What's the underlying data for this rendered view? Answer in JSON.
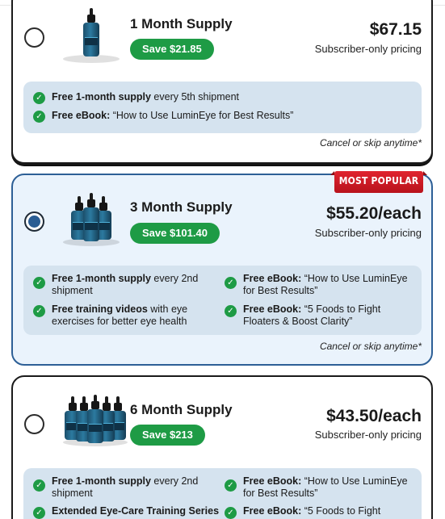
{
  "plans": [
    {
      "name": "1 Month Supply",
      "save": "Save $21.85",
      "price": "$67.15",
      "price_note": "Subscriber-only pricing",
      "selected": false,
      "bottles": 1,
      "perks": [
        {
          "bold": "Free 1-month supply",
          "text": " every 5th shipment"
        },
        {
          "bold": "Free eBook:",
          "text": " “How to Use LuminEye for Best Results”"
        }
      ],
      "cancel_note": "Cancel or skip anytime*"
    },
    {
      "name": "3 Month Supply",
      "save": "Save $101.40",
      "price": "$55.20/each",
      "price_note": "Subscriber-only pricing",
      "selected": true,
      "badge": "MOST POPULAR",
      "bottles": 3,
      "perks": [
        {
          "bold": "Free 1-month supply",
          "text": " every 2nd shipment"
        },
        {
          "bold": "Free eBook:",
          "text": " “How to Use LuminEye for Best Results”"
        },
        {
          "bold": "Free training videos",
          "text": " with eye exercises for better eye health"
        },
        {
          "bold": "Free eBook:",
          "text": " “5 Foods to Fight Floaters & Boost Clarity”"
        }
      ],
      "cancel_note": "Cancel or skip anytime*"
    },
    {
      "name": "6 Month Supply",
      "save": "Save $213",
      "price": "$43.50/each",
      "price_note": "Subscriber-only pricing",
      "selected": false,
      "bottles": 5,
      "perks": [
        {
          "bold": "Free 1-month supply",
          "text": " every 2nd shipment"
        },
        {
          "bold": "Free eBook:",
          "text": " “How to Use LuminEye for Best Results”"
        },
        {
          "bold": "Extended Eye-Care Training Series",
          "text": ""
        },
        {
          "bold": "Free eBook:",
          "text": " “5 Foods to Fight"
        }
      ]
    }
  ],
  "colors": {
    "save_green": "#1e9b45",
    "popular_border": "#2d5f96",
    "popular_bg": "#eaf3fc",
    "perks_bg": "#d5e3ef",
    "badge_red": "#d01c26"
  },
  "icons": {
    "check": "check-circle-icon",
    "product": "dropper-bottle-icon"
  }
}
